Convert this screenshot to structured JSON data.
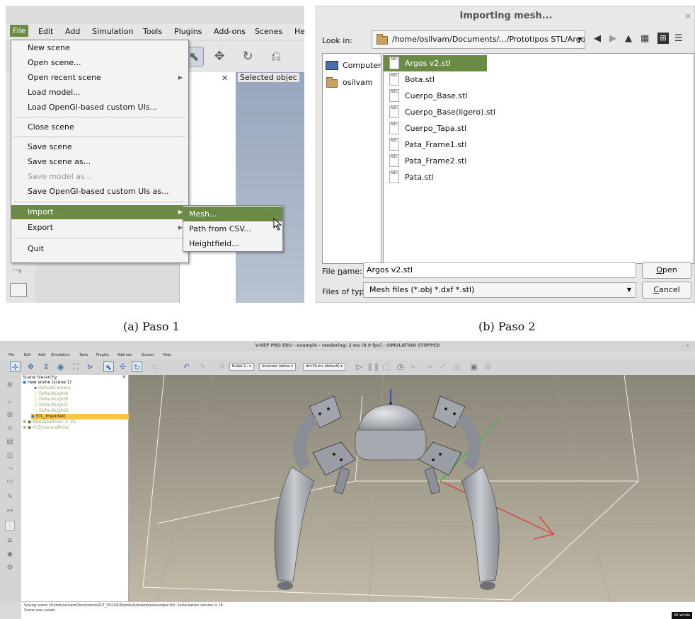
{
  "panel_a": {
    "caption": "(a) Paso 1",
    "menubar": [
      "File",
      "Edit",
      "Add",
      "Simulation",
      "Tools",
      "Plugins",
      "Add-ons",
      "Scenes",
      "He"
    ],
    "menu_items": [
      "New scene",
      "Open scene...",
      "Open recent scene",
      "Load model...",
      "Load OpenGl-based custom UIs...",
      "Close scene",
      "Save scene",
      "Save scene as...",
      "Save model as...",
      "Save OpenGl-based custom UIs as...",
      "Import",
      "Export",
      "Quit"
    ],
    "submenu_items": [
      "Mesh...",
      "Path from CSV...",
      "Heightfield..."
    ],
    "selected_object_label": "Selected objec",
    "close_glyph": "✕"
  },
  "panel_b": {
    "caption": "(b) Paso 2",
    "title": "Importing mesh...",
    "look_in_label": "Look in:",
    "path": "/home/osilvam/Documents/.../Prototipos STL/Argos v2",
    "sidebar_items": [
      "Computer",
      "osilvam"
    ],
    "files": [
      "Argos v2.stl",
      "Bota.stl",
      "Cuerpo_Base.stl",
      "Cuerpo_Base(ligero).stl",
      "Cuerpo_Tapa.stl",
      "Pata_Frame1.stl",
      "Pata_Frame2.stl",
      "Pata.stl"
    ],
    "selected_file": "Argos v2.stl",
    "file_name_label_pre": "File ",
    "file_name_label_u": "n",
    "file_name_label_post": "ame:",
    "file_name_value": "Argos v2.stl",
    "files_of_type_label": "Files of type:",
    "files_of_type_value": "Mesh files (*.obj *.dxf *.stl)",
    "open_u": "O",
    "open_rest": "pen",
    "cancel_u": "C",
    "cancel_rest": "ancel",
    "file_icon_text": "ABC"
  },
  "panel_c": {
    "title": "V-REP PRO EDU - example - rendering: 2 ms (8.0 fps) - SIMULATION STOPPED",
    "menubar": [
      "File",
      "Edit",
      "Add",
      "Simulation",
      "Tools",
      "Plugins",
      "Add-ons",
      "Scenes",
      "Help"
    ],
    "toolbar_selects": [
      "Bullet 2.:",
      "Accurate (defau",
      "dt=50 ms (default)"
    ],
    "hierarchy_title": "Scene hierarchy",
    "hierarchy": [
      "new scene (scene 1)",
      "DefaultCamera",
      "DefaultLightA",
      "DefaultLightB",
      "DefaultLightC",
      "DefaultLightD",
      "STL_Imported",
      "ResizableFloor_5_25",
      "XYZCameraProxy"
    ],
    "status_lines": [
      "Saving scene (/home/osilvam/Documents/GIT_OSCAR/RobotLib/example/example.ttt). Serialization version is 18.",
      "Scene was saved."
    ],
    "all_windows": "All windo",
    "window_controls": "–  ×"
  },
  "colors": {
    "highlight_green": "#6a8a45",
    "selected_yellow": "#f6c64a",
    "viewport_blue": "#a4b1c6"
  }
}
